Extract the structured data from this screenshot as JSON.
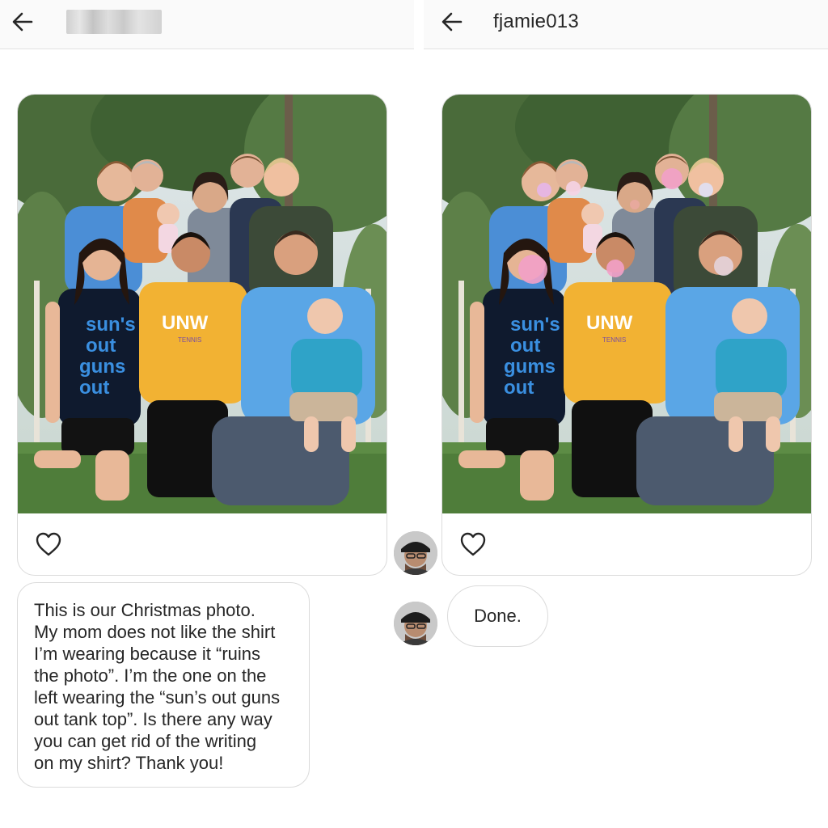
{
  "left_pane": {
    "message": "This is our Christmas photo.\nMy mom does not like the shirt\nI’m wearing because it “ruins\nthe photo”. I’m the one on the\nleft wearing the “sun’s out guns\nout tank top”. Is there any way\nyou can get rid of the writing\non my shirt? Thank you!",
    "photo": {
      "shirt_text": [
        "sun's",
        "out",
        "guns",
        "out"
      ],
      "tshirt_logo": "UNW",
      "tshirt_sub": "TENNIS"
    }
  },
  "right_pane": {
    "username": "fjamie013",
    "reply": "Done.",
    "photo": {
      "shirt_text": [
        "sun's",
        "out",
        "gums",
        "out"
      ],
      "tshirt_logo": "UNW",
      "tshirt_sub": "TENNIS"
    }
  },
  "icons": {
    "back": "arrow-left-icon",
    "heart": "heart-outline-icon",
    "avatar": "user-avatar"
  },
  "colors": {
    "border": "#dbdbdb",
    "header_bg": "#fafafa",
    "text": "#262626",
    "tank_top": "#0f1a2e",
    "shirt_lettering": "#3a8fe0",
    "yellow_tshirt": "#f2b233",
    "blue_polo": "#5aa6e6",
    "grass": "#4f7d3a",
    "gum_pink": "#f2a0c8"
  }
}
